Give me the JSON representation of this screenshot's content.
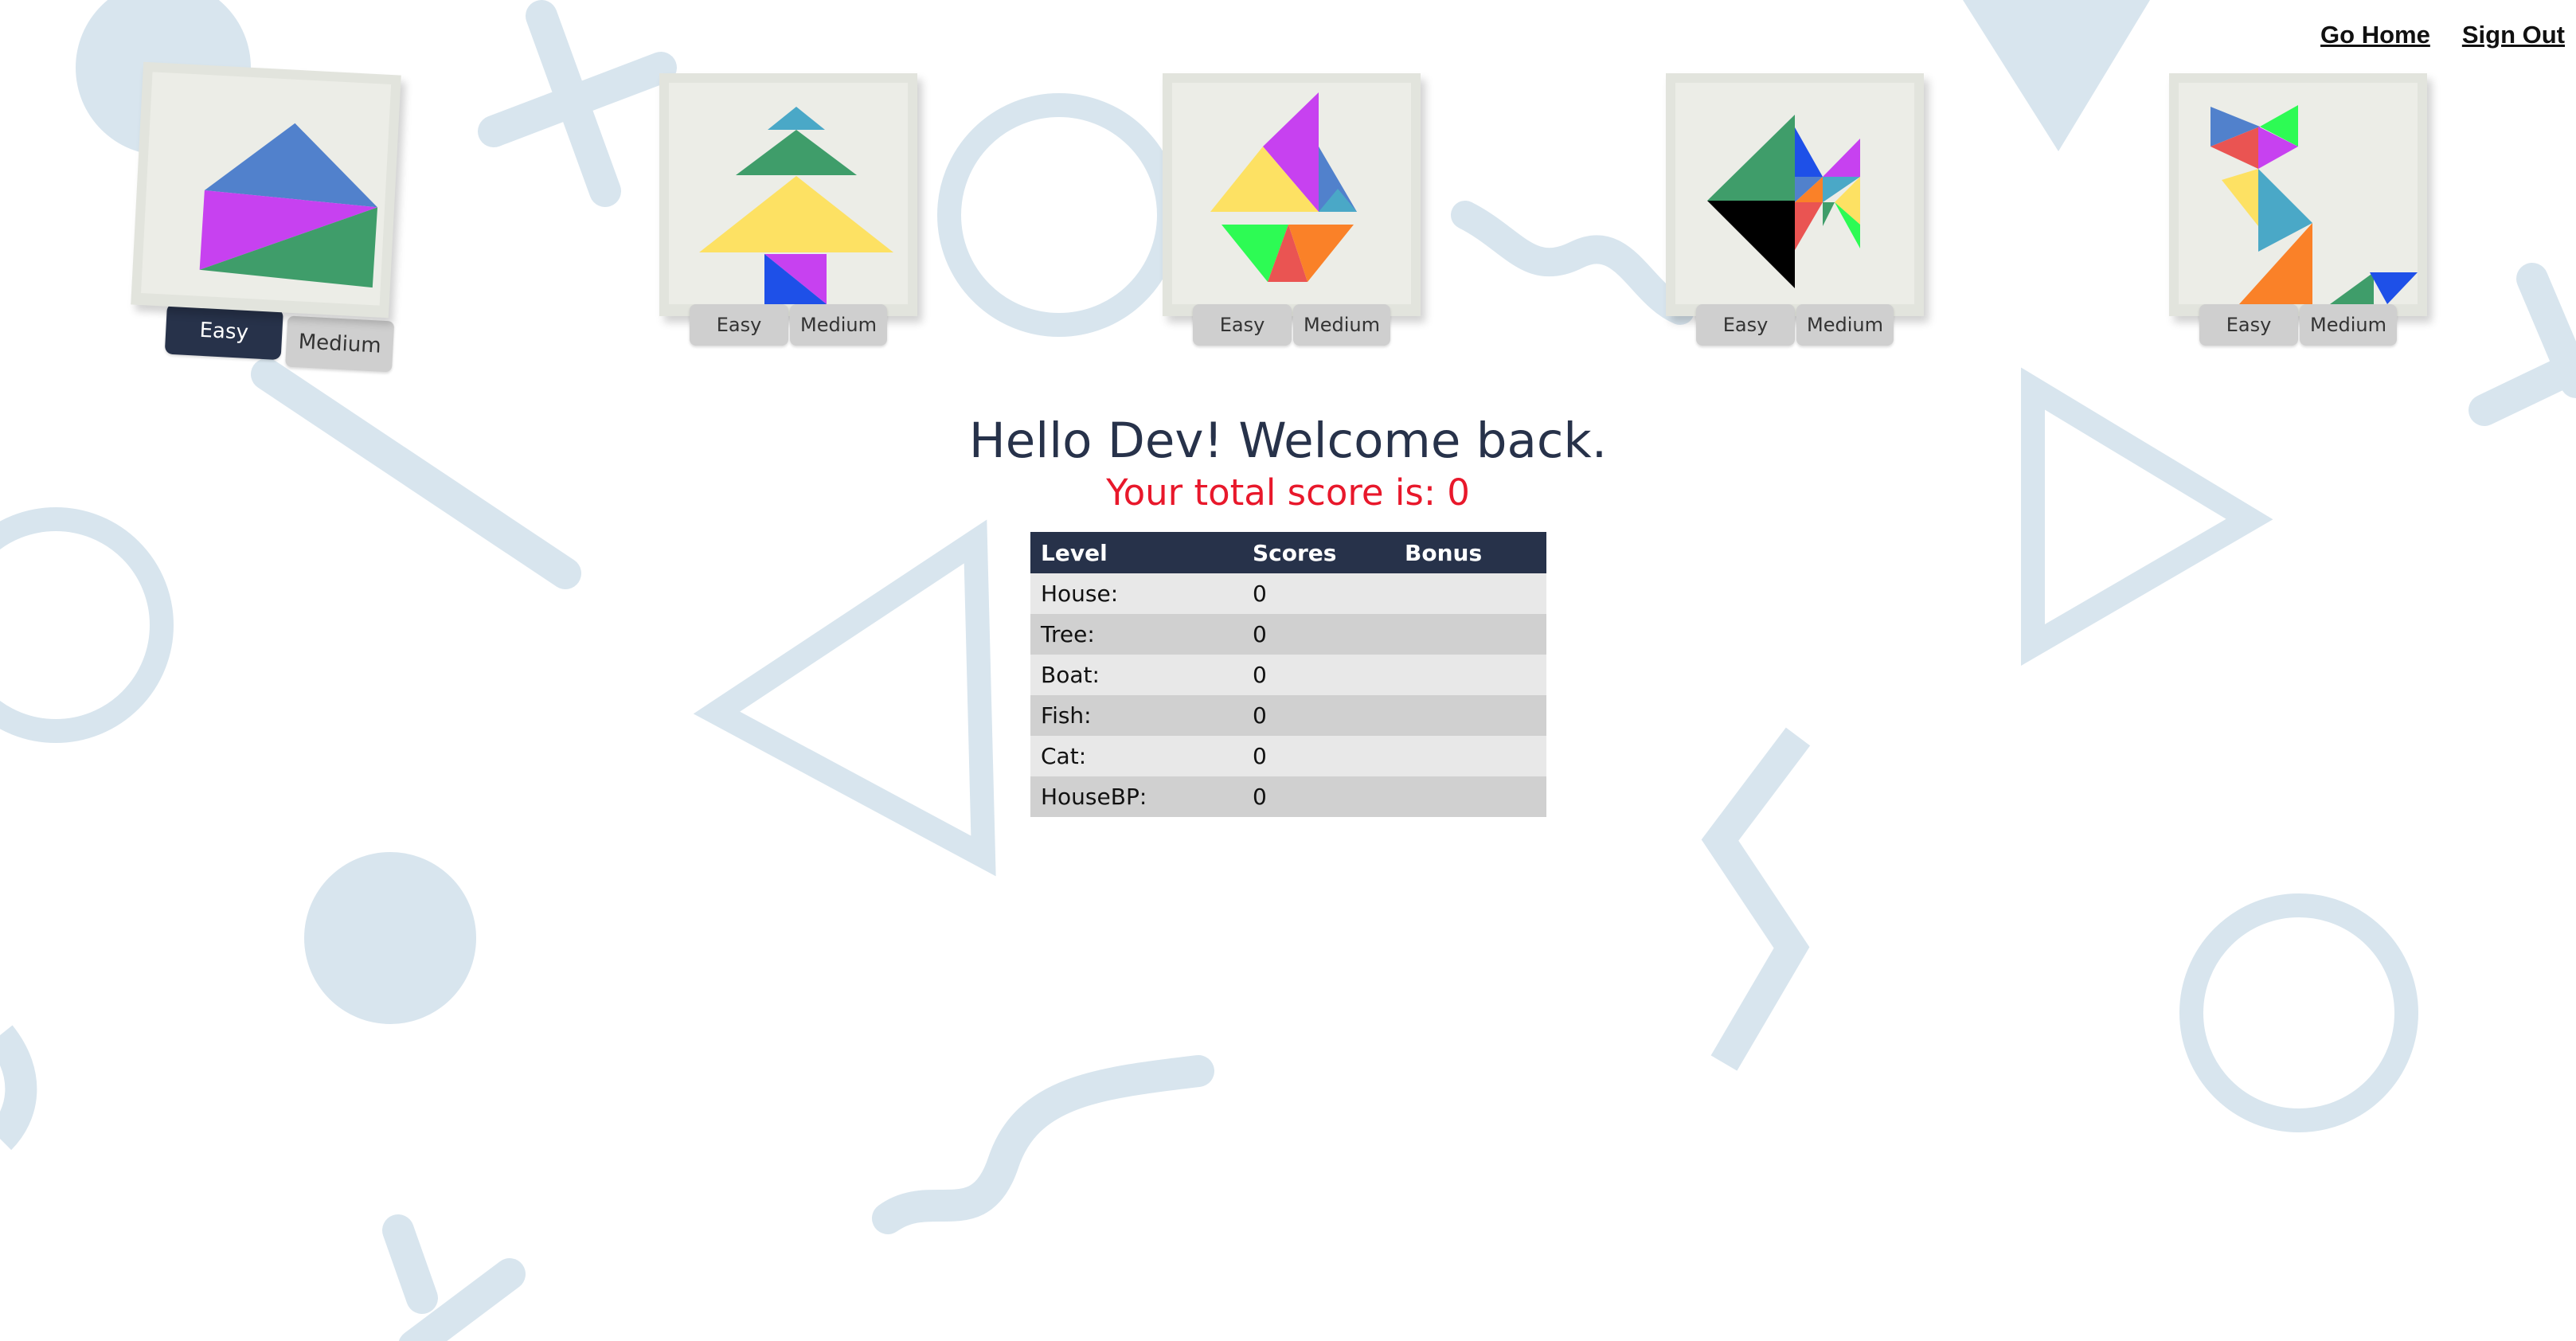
{
  "nav": {
    "home_label": "Go Home",
    "signout_label": "Sign Out"
  },
  "puzzles": [
    {
      "name": "House",
      "easy_label": "Easy",
      "medium_label": "Medium",
      "selected": "Easy"
    },
    {
      "name": "Tree",
      "easy_label": "Easy",
      "medium_label": "Medium"
    },
    {
      "name": "Boat",
      "easy_label": "Easy",
      "medium_label": "Medium"
    },
    {
      "name": "Fish",
      "easy_label": "Easy",
      "medium_label": "Medium"
    },
    {
      "name": "Cat",
      "easy_label": "Easy",
      "medium_label": "Medium"
    }
  ],
  "greeting": "Hello Dev! Welcome back.",
  "total_score": "Your total score is: 0",
  "table": {
    "headers": [
      "Level",
      "Scores",
      "Bonus"
    ],
    "rows": [
      {
        "level": "House:",
        "score": "0",
        "bonus": ""
      },
      {
        "level": "Tree:",
        "score": "0",
        "bonus": ""
      },
      {
        "level": "Boat:",
        "score": "0",
        "bonus": ""
      },
      {
        "level": "Fish:",
        "score": "0",
        "bonus": ""
      },
      {
        "level": "Cat:",
        "score": "0",
        "bonus": ""
      },
      {
        "level": "HouseBP:",
        "score": "0",
        "bonus": ""
      }
    ]
  },
  "colors": {
    "accent_dark": "#27324a",
    "score_red": "#e8182b",
    "background_shapes": "#d8e5ee",
    "button_grey": "#cfcfcf"
  }
}
